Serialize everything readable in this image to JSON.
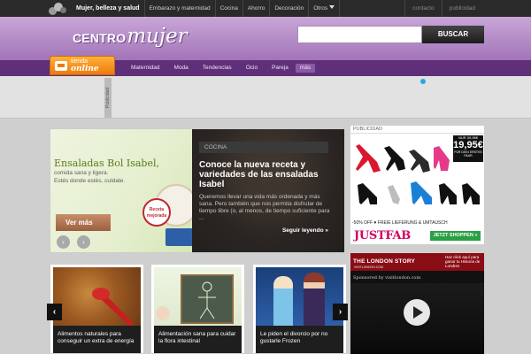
{
  "topbar": {
    "nav": [
      "Mujer, belleza y salud",
      "Embarazo y maternidad",
      "Cocina",
      "Ahorro",
      "Decoración",
      "Otros"
    ],
    "links": [
      "contacto",
      "publicidad"
    ]
  },
  "header": {
    "logo_part1": "CENTRO",
    "logo_part2": "mujer",
    "search_placeholder": "",
    "search_button": "BUSCAR"
  },
  "nav": {
    "tienda_line1": "tienda",
    "tienda_line2": "online",
    "items": [
      "Maternidad",
      "Moda",
      "Tendencias",
      "Ocio",
      "Pareja",
      "más"
    ]
  },
  "adband": {
    "vertical_label": "Publicidad"
  },
  "slider": {
    "image_title": "Ensaladas Bol Isabel,",
    "image_sub1": "comida sana y ligera.",
    "image_sub2": "Estés donde estés, cuídate.",
    "stamp_text": "Receta mejorada",
    "more_button": "Ver más",
    "prev_icon": "‹",
    "next_icon": "›",
    "category": "COCINA",
    "title": "Conoce la nueva receta y variedades de las ensaladas Isabel",
    "description": "Queremos llevar una vida más ordenada y más sana. Pero también que nos permita disfrutar de tiempo libre (o, al menos, de tiempo suficiente para ...",
    "read_more": "Seguir leyendo »"
  },
  "sidebar_ad": {
    "label": "PUBLICIDAD",
    "price_top": "NUR 39,95€",
    "price_main": "19,95€",
    "price_bottom": "FÜR DEIN ERSTES PAAR",
    "strip_text": "-50% OFF  ♥ FREIE LIEFERUNG & UMTAUSCH",
    "brand": "JUSTFAB",
    "cta": "JETZT SHOPPEN »"
  },
  "london_ad": {
    "title": "THE LONDON STORY",
    "subtitle": "VISITLONDON.COM",
    "side_text": "Haz click aquí para ganar tu Historia de Londres",
    "sponsor": "Sponsored by visitlondon.com"
  },
  "cards": [
    {
      "caption": "Alimentos naturales para conseguir un extra de energía"
    },
    {
      "caption": "Alimentación sana para cuidar la flora intestinal"
    },
    {
      "caption": "Le piden el divorcio por no gustarle Frozen"
    }
  ],
  "carousel": {
    "left_icon": "‹",
    "right_icon": "›"
  },
  "colors": {
    "topbar": "#2a2a2a",
    "header_purple": "#a274b8",
    "nav_purple": "#5f2f7a",
    "tienda_orange": "#ee7b0c",
    "justfab_pink": "#d1005f"
  }
}
